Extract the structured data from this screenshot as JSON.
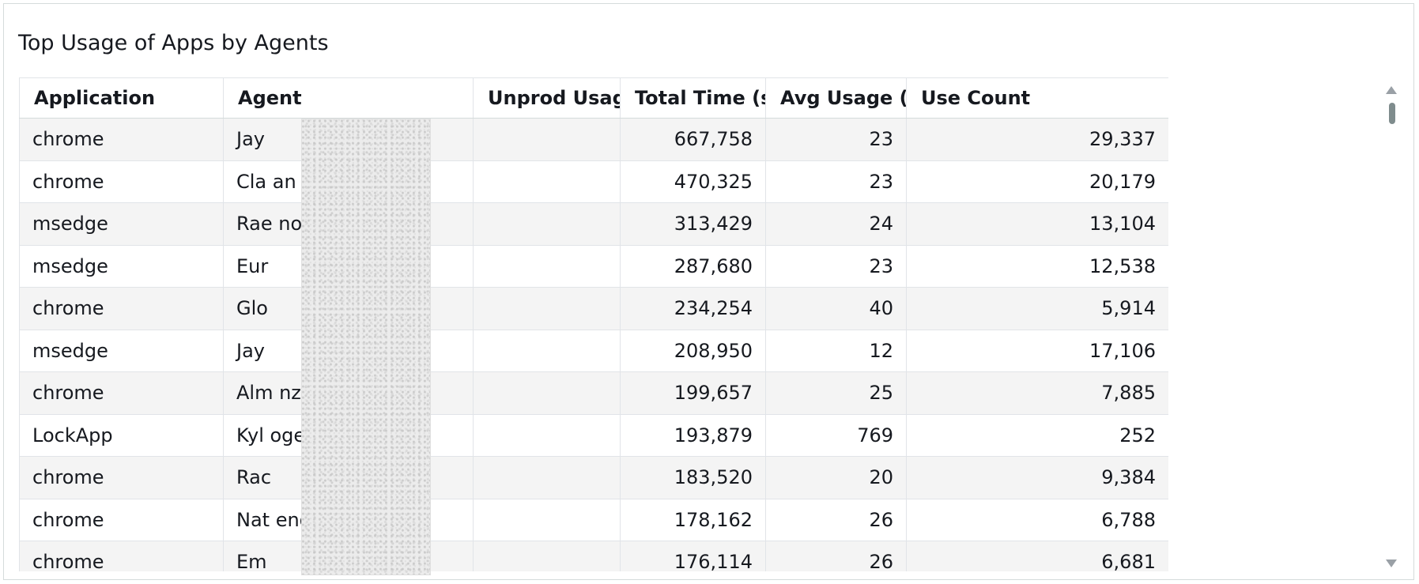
{
  "panel": {
    "title": "Top Usage of Apps by Agents"
  },
  "table": {
    "columns": [
      "Application",
      "Agent",
      "Unprod Usage",
      "Total Time (s)",
      "Avg Usage (s)",
      "Use Count"
    ],
    "rows": [
      [
        "chrome",
        "Jay",
        "",
        "667,758",
        "23",
        "29,337"
      ],
      [
        "chrome",
        "Cla                       an",
        "",
        "470,325",
        "23",
        "20,179"
      ],
      [
        "msedge",
        "Rae                       no",
        "",
        "313,429",
        "24",
        "13,104"
      ],
      [
        "msedge",
        "Eur",
        "",
        "287,680",
        "23",
        "12,538"
      ],
      [
        "chrome",
        "Glo",
        "",
        "234,254",
        "40",
        "5,914"
      ],
      [
        "msedge",
        "Jay",
        "",
        "208,950",
        "12",
        "17,106"
      ],
      [
        "chrome",
        "Alm                       nzales",
        "",
        "199,657",
        "25",
        "7,885"
      ],
      [
        "LockApp",
        "Kyl                       ogenes",
        "",
        "193,879",
        "769",
        "252"
      ],
      [
        "chrome",
        "Rac",
        "",
        "183,520",
        "20",
        "9,384"
      ],
      [
        "chrome",
        "Nat                       enoja",
        "",
        "178,162",
        "26",
        "6,788"
      ],
      [
        "chrome",
        "Em",
        "",
        "176,114",
        "26",
        "6,681"
      ]
    ]
  }
}
